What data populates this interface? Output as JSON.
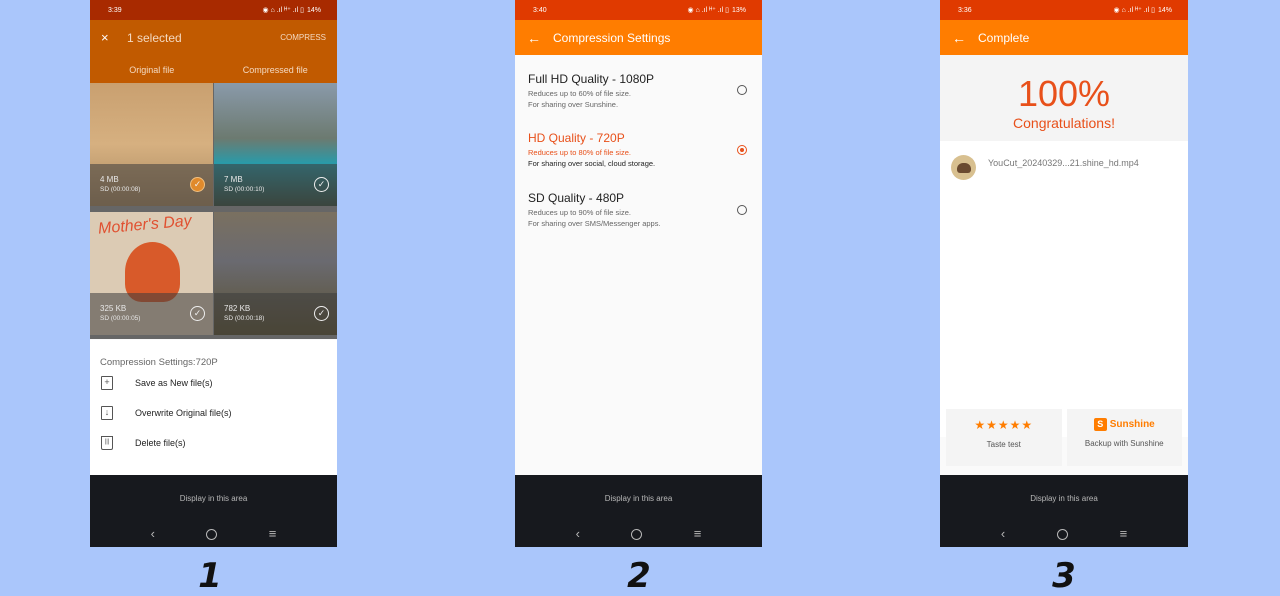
{
  "screens": [
    {
      "status": {
        "time": "3:39",
        "battery": "14%"
      },
      "selection_bar": {
        "close_icon": "×",
        "title": "1 selected",
        "compress_label": "COMPRESS"
      },
      "tabs": [
        "Original file",
        "Compressed file"
      ],
      "videos": [
        {
          "size": "4 MB",
          "duration": "SD (00:00:08)",
          "checked": true
        },
        {
          "size": "7 MB",
          "duration": "SD (00:00:10)",
          "checked": false
        },
        {
          "size": "325 KB",
          "duration": "SD (00:00:05)",
          "checked": false
        },
        {
          "size": "782 KB",
          "duration": "SD (00:00:18)",
          "checked": false
        }
      ],
      "thumb_texts": {
        "mothers_day": "Mother's Day"
      },
      "sheet": {
        "header": "Compression Settings:720P",
        "items": [
          {
            "icon": "add-file-icon",
            "glyph": "+",
            "label": "Save as New file(s)"
          },
          {
            "icon": "overwrite-icon",
            "glyph": "↓",
            "label": "Overwrite Original file(s)"
          },
          {
            "icon": "trash-icon",
            "glyph": "|||",
            "label": "Delete file(s)"
          }
        ]
      },
      "ad_text": "Display in this area",
      "step": "1"
    },
    {
      "status": {
        "time": "3:40",
        "battery": "13%"
      },
      "appbar": {
        "back_icon": "←",
        "title": "Compression Settings"
      },
      "options": [
        {
          "title": "Full HD Quality - 1080P",
          "desc1": "Reduces up to 60% of file size.",
          "desc2": "For sharing over Sunshine.",
          "selected": false
        },
        {
          "title": "HD Quality - 720P",
          "desc1": "Reduces up to 80% of file size.",
          "desc2": "For sharing over social, cloud storage.",
          "selected": true
        },
        {
          "title": "SD Quality - 480P",
          "desc1": "Reduces up to 90% of file size.",
          "desc2": "For sharing over SMS/Messenger apps.",
          "selected": false
        }
      ],
      "ad_text": "Display in this area",
      "step": "2"
    },
    {
      "status": {
        "time": "3:36",
        "battery": "14%"
      },
      "appbar": {
        "back_icon": "←",
        "title": "Complete"
      },
      "progress": "100%",
      "congrats": "Congratulations!",
      "file_name": "YouCut_20240329...21.shine_hd.mp4",
      "cards": [
        {
          "stars": "★★★★★",
          "label": "Taste test"
        },
        {
          "brand_glyph": "S",
          "brand": "Sunshine",
          "label": "Backup with Sunshine"
        }
      ],
      "ad_text": "Display in this area",
      "step": "3"
    }
  ],
  "nav": {
    "back": "‹",
    "menu": "≡"
  },
  "status_icons": "◉ ⌂ .ıl ᴴ⁺ .ıl ▯",
  "colors": {
    "accent": "#ff7d00",
    "status": "#e03a00",
    "selected": "#e8501a",
    "background": "#aac6fb"
  }
}
